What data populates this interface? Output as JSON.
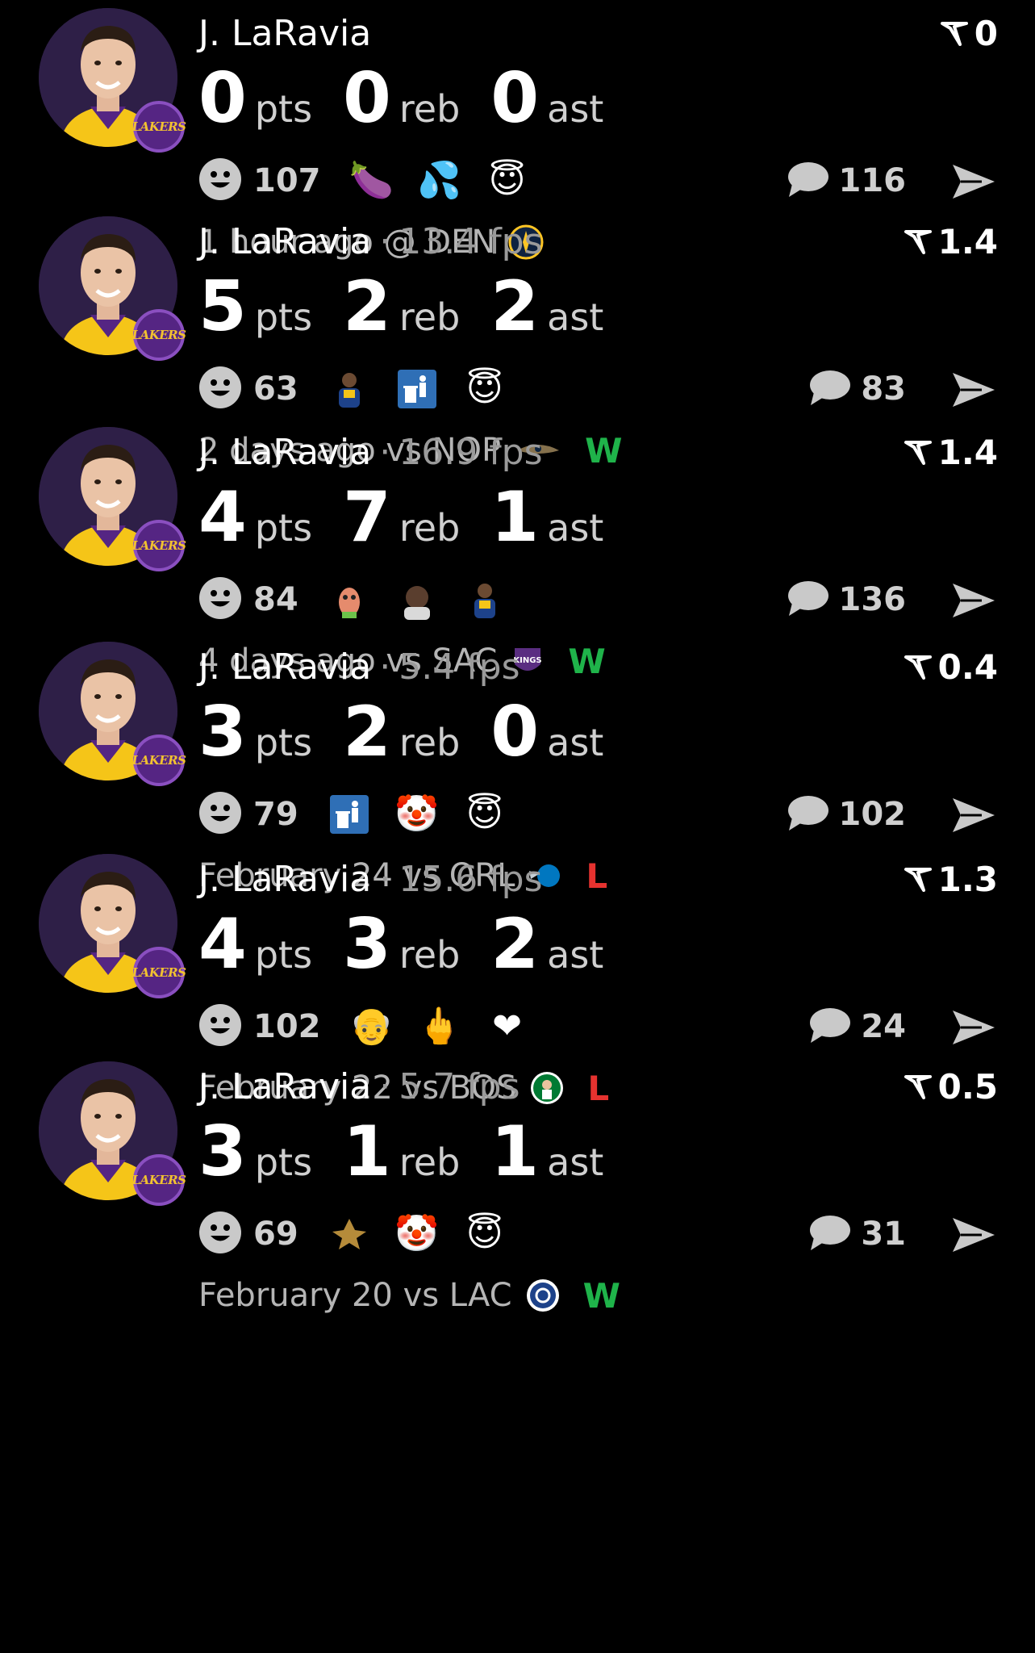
{
  "posts": [
    {
      "player": "J. LaRavia",
      "fps": "",
      "rating": "0",
      "pts": "0",
      "pts_label": "pts",
      "reb": "0",
      "reb_label": "reb",
      "ast": "0",
      "ast_label": "ast",
      "reactions_count": "107",
      "emojis": [
        "eggplant-emoji",
        "sweat-droplets-emoji",
        "angel-emoji"
      ],
      "comments": "116",
      "meta": "1 hour ago @ DEN",
      "opponent_logo": "nuggets-logo",
      "result": ""
    },
    {
      "player": "J. LaRavia",
      "fps": "13.4 fps",
      "rating": "1.4",
      "pts": "5",
      "pts_label": "pts",
      "reb": "2",
      "reb_label": "reb",
      "ast": "2",
      "ast_label": "ast",
      "reactions_count": "63",
      "emojis": [
        "player-sticker",
        "trash-can-emoji",
        "angel-emoji"
      ],
      "comments": "83",
      "meta": "2 days ago vs NOP",
      "opponent_logo": "pelicans-logo",
      "result": "W"
    },
    {
      "player": "J. LaRavia",
      "fps": "16.9 fps",
      "rating": "1.4",
      "pts": "4",
      "pts_label": "pts",
      "reb": "7",
      "reb_label": "reb",
      "ast": "1",
      "ast_label": "ast",
      "reactions_count": "84",
      "emojis": [
        "cartoon-sticker",
        "face-sticker",
        "player-sticker"
      ],
      "comments": "136",
      "meta": "4 days ago vs SAC",
      "opponent_logo": "kings-logo",
      "result": "W"
    },
    {
      "player": "J. LaRavia",
      "fps": "5.4 fps",
      "rating": "0.4",
      "pts": "3",
      "pts_label": "pts",
      "reb": "2",
      "reb_label": "reb",
      "ast": "0",
      "ast_label": "ast",
      "reactions_count": "79",
      "emojis": [
        "trash-can-emoji",
        "clown-emoji",
        "angel-emoji"
      ],
      "comments": "102",
      "meta": "February 24 vs ORL",
      "opponent_logo": "magic-logo",
      "result": "L"
    },
    {
      "player": "J. LaRavia",
      "fps": "15.6 fps",
      "rating": "1.3",
      "pts": "4",
      "pts_label": "pts",
      "reb": "3",
      "reb_label": "reb",
      "ast": "2",
      "ast_label": "ast",
      "reactions_count": "102",
      "emojis": [
        "old-man-emoji",
        "middle-finger-emoji",
        "heart-emoji"
      ],
      "comments": "24",
      "meta": "February 22 vs BOS",
      "opponent_logo": "celtics-logo",
      "result": "L"
    },
    {
      "player": "J. LaRavia",
      "fps": "5.7 fps",
      "rating": "0.5",
      "pts": "3",
      "pts_label": "pts",
      "reb": "1",
      "reb_label": "reb",
      "ast": "1",
      "ast_label": "ast",
      "reactions_count": "69",
      "emojis": [
        "emblem-sticker",
        "clown-emoji",
        "angel-emoji"
      ],
      "comments": "31",
      "meta": "February 20 vs LAC",
      "opponent_logo": "clippers-logo",
      "result": "W"
    }
  ],
  "team_badge_text": "LAKERS",
  "colors": {
    "background": "#000000",
    "muted": "#9a9a9a",
    "win": "#1fb34a",
    "loss": "#e5322f",
    "lakers_purple": "#552583",
    "lakers_gold": "#f2c230"
  }
}
